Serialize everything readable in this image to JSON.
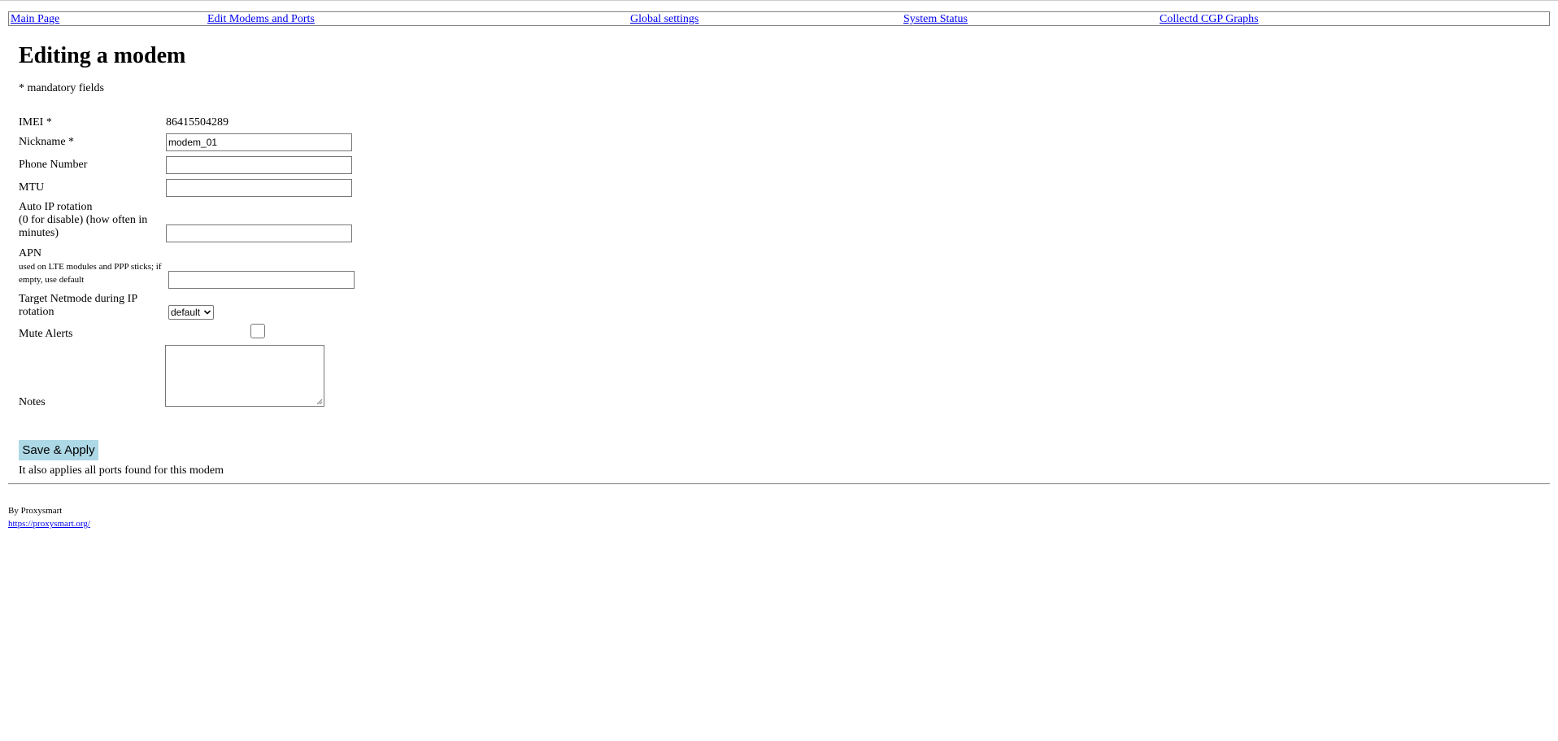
{
  "nav": {
    "items": [
      {
        "label": "Main Page"
      },
      {
        "label": "Edit Modems and Ports"
      },
      {
        "label": "Global settings"
      },
      {
        "label": "System Status"
      },
      {
        "label": "Collectd CGP Graphs"
      }
    ]
  },
  "page": {
    "title": "Editing a modem",
    "mandatory_note": "* mandatory fields"
  },
  "form": {
    "imei": {
      "label": "IMEI *",
      "value": "86415504289"
    },
    "nickname": {
      "label": "Nickname *",
      "value": "modem_01"
    },
    "phone_number": {
      "label": "Phone Number",
      "value": ""
    },
    "mtu": {
      "label": "MTU",
      "value": ""
    },
    "auto_ip_rotation": {
      "label_line1": "Auto IP rotation",
      "label_line2": "(0 for disable) (how often in",
      "label_line3": "minutes)",
      "value": ""
    },
    "apn": {
      "label": "APN",
      "hint_line1": "used on LTE modules and PPP sticks; if",
      "hint_line2": "empty, use default",
      "value": ""
    },
    "target_netmode": {
      "label_line1": "Target Netmode during IP",
      "label_line2": "rotation",
      "selected": "default"
    },
    "mute_alerts": {
      "label": "Mute Alerts",
      "checked": false
    },
    "notes": {
      "label": "Notes",
      "value": ""
    },
    "save_button": "Save & Apply",
    "apply_note": "It also applies all ports found for this modem"
  },
  "footer": {
    "by": "By Proxysmart",
    "link": "https://proxysmart.org/"
  },
  "colors": {
    "link": "#0000ee",
    "save_button_bg": "#add8e6",
    "border": "#767676"
  }
}
